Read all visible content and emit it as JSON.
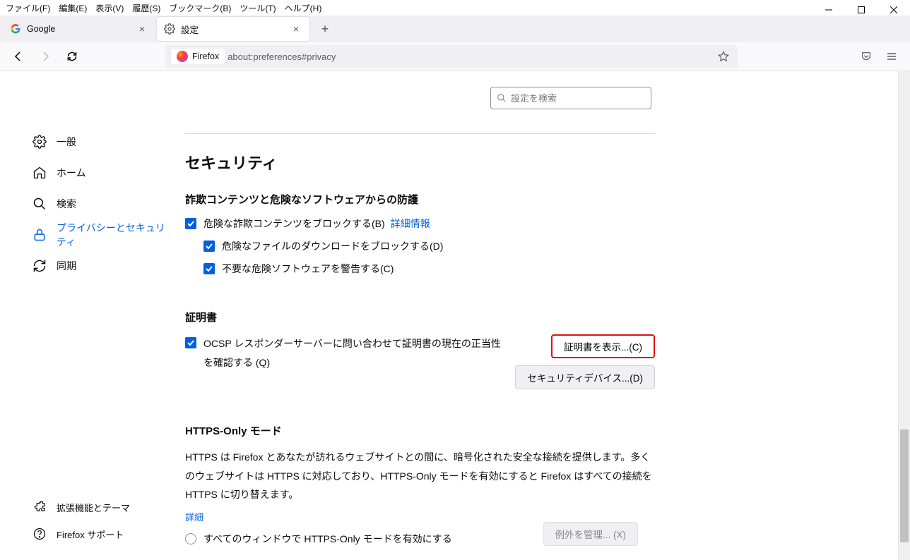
{
  "menubar": {
    "file": "ファイル(F)",
    "edit": "編集(E)",
    "view": "表示(V)",
    "history": "履歴(S)",
    "bookmarks": "ブックマーク(B)",
    "tools": "ツール(T)",
    "help": "ヘルプ(H)"
  },
  "tabs": {
    "t0": {
      "title": "Google"
    },
    "t1": {
      "title": "設定"
    }
  },
  "urlbar": {
    "identity": "Firefox",
    "url": "about:preferences#privacy"
  },
  "sidebar": {
    "general": "一般",
    "home": "ホーム",
    "search": "検索",
    "privacy": "プライバシーとセキュリティ",
    "sync": "同期",
    "ext": "拡張機能とテーマ",
    "support": "Firefox サポート"
  },
  "search": {
    "placeholder": "設定を検索"
  },
  "security": {
    "heading": "セキュリティ",
    "deceptive": {
      "title": "詐欺コンテンツと危険なソフトウェアからの防護",
      "block_label": "危険な詐欺コンテンツをブロックする(B)",
      "more": "詳細情報",
      "downloads": "危険なファイルのダウンロードをブロックする(D)",
      "unwanted": "不要な危険ソフトウェアを警告する(C)"
    },
    "certs": {
      "title": "証明書",
      "ocsp": "OCSP レスポンダーサーバーに問い合わせて証明書の現在の正当性を確認する (Q)",
      "view": "証明書を表示...(C)",
      "devices": "セキュリティデバイス...(D)"
    },
    "https": {
      "title": "HTTPS-Only モード",
      "desc": "HTTPS は Firefox とあなたが訪れるウェブサイトとの間に、暗号化された安全な接続を提供します。多くのウェブサイトは HTTPS に対応しており、HTTPS-Only モードを有効にすると Firefox はすべての接続を HTTPS に切り替えます。",
      "more": "詳細",
      "all": "すべてのウィンドウで HTTPS-Only モードを有効にする",
      "manage": "例外を管理... (X)"
    }
  }
}
